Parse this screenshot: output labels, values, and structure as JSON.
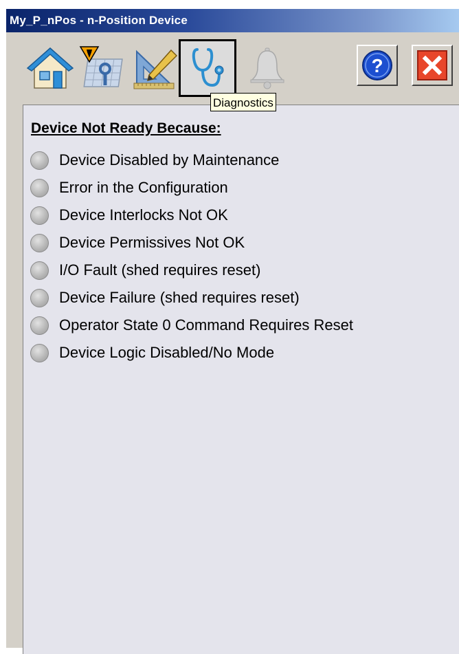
{
  "window": {
    "title": "My_P_nPos - n-Position Device"
  },
  "toolbar": {
    "home_icon": "home-icon",
    "maintenance_icon": "maintenance-icon",
    "engineering_icon": "engineering-icon",
    "diagnostics_icon": "diagnostics-icon",
    "alarms_icon": "alarms-bell-icon",
    "help_icon": "help-icon",
    "close_icon": "close-icon",
    "selected_tab": "diagnostics"
  },
  "tooltip": {
    "text": "Diagnostics"
  },
  "diagnostics": {
    "heading": "Device Not Ready Because:",
    "reasons": [
      {
        "label": "Device Disabled by Maintenance",
        "state": "off"
      },
      {
        "label": "Error in the Configuration",
        "state": "off"
      },
      {
        "label": "Device Interlocks Not OK",
        "state": "off"
      },
      {
        "label": "Device Permissives Not OK",
        "state": "off"
      },
      {
        "label": "I/O Fault (shed requires reset)",
        "state": "off"
      },
      {
        "label": "Device Failure (shed requires reset)",
        "state": "off"
      },
      {
        "label": "Operator State 0 Command Requires Reset",
        "state": "off"
      },
      {
        "label": "Device Logic Disabled/No Mode",
        "state": "off"
      }
    ]
  },
  "colors": {
    "titlebar_start": "#0a246a",
    "titlebar_end": "#a6caf0",
    "panel_background": "#e4e4ec",
    "indicator_off": "#b4b4b4",
    "close_red": "#e8462a",
    "help_blue": "#1c4fd0"
  }
}
